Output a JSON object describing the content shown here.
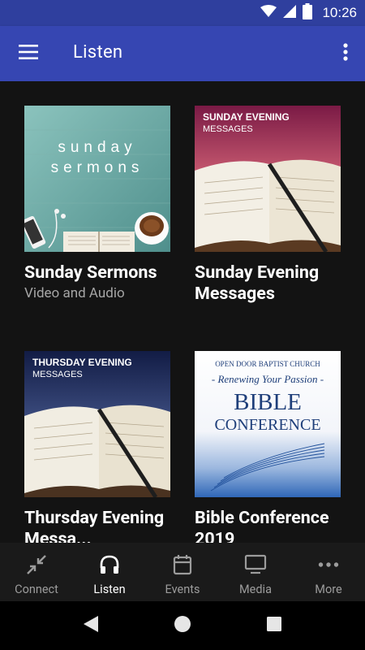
{
  "status_bar": {
    "time": "10:26",
    "icons": [
      "wifi-icon",
      "cell-signal-icon",
      "battery-icon"
    ]
  },
  "app_bar": {
    "title": "Listen",
    "menu_icon": "hamburger-menu-icon",
    "overflow_icon": "more-vertical-icon",
    "background": "#3646b2"
  },
  "cards": [
    {
      "title": "Sunday Sermons",
      "subtitle": "Video and Audio",
      "art_text": [
        "sunday",
        "sermons"
      ]
    },
    {
      "title": "Sunday Evening Messages",
      "subtitle": "",
      "art_text": [
        "SUNDAY EVENING",
        "MESSAGES"
      ]
    },
    {
      "title": "Thursday Evening Messa...",
      "subtitle": "",
      "art_text": [
        "THURSDAY EVENING",
        "MESSAGES"
      ]
    },
    {
      "title": "Bible Conference 2019",
      "subtitle": "",
      "art_text": [
        "OPEN DOOR BAPTIST CHURCH",
        "- Renewing Your Passion -",
        "BIBLE",
        "CONFERENCE"
      ]
    }
  ],
  "bottom_nav": {
    "items": [
      {
        "label": "Connect",
        "icon": "connect-arrows-icon",
        "active": false
      },
      {
        "label": "Listen",
        "icon": "headphones-icon",
        "active": true
      },
      {
        "label": "Events",
        "icon": "calendar-icon",
        "active": false
      },
      {
        "label": "Media",
        "icon": "monitor-icon",
        "active": false
      },
      {
        "label": "More",
        "icon": "more-horizontal-icon",
        "active": false
      }
    ]
  },
  "system_nav": {
    "icons": [
      "back-icon",
      "home-icon",
      "recents-icon"
    ]
  }
}
